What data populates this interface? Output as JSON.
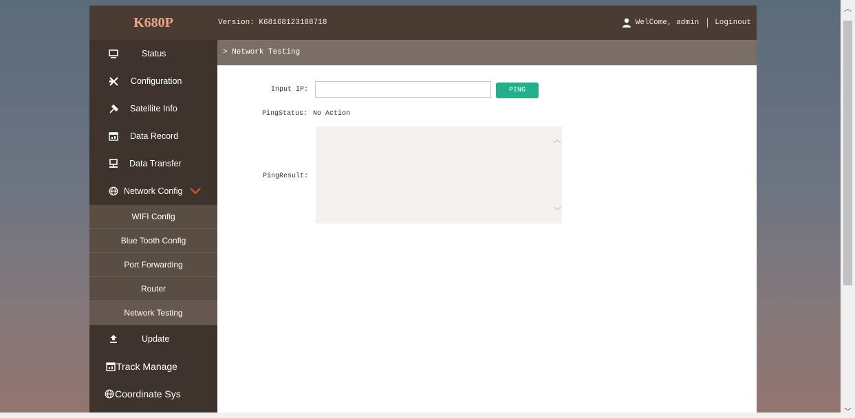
{
  "header": {
    "logo": "K680P",
    "version_label": "Version:",
    "version": "K68168123188718",
    "welcome": "WelCome, admin",
    "logout": "Loginout"
  },
  "sidebar": {
    "items": [
      {
        "label": "Status",
        "icon": "monitor-icon"
      },
      {
        "label": "Configuration",
        "icon": "tools-icon"
      },
      {
        "label": "Satellite Info",
        "icon": "satellite-icon"
      },
      {
        "label": "Data Record",
        "icon": "calendar-icon"
      },
      {
        "label": "Data Transfer",
        "icon": "network-icon"
      },
      {
        "label": "Network Config",
        "icon": "globe-icon",
        "expanded": true
      }
    ],
    "subitems": [
      "WIFI Config",
      "Blue Tooth Config",
      "Port Forwarding",
      "Router",
      "Network Testing"
    ],
    "more_items": [
      {
        "label": "Update",
        "icon": "upload-icon"
      },
      {
        "label": "Track Manage",
        "icon": "calendar-icon"
      },
      {
        "label": "Coordinate Sys",
        "icon": "globe-icon"
      }
    ]
  },
  "breadcrumb": "> Network Testing",
  "form": {
    "input_ip_label": "Input IP:",
    "input_ip_value": "",
    "ping_button": "PING",
    "ping_status_label": "PingStatus:",
    "ping_status_value": "No Action",
    "ping_result_label": "PingResult:",
    "ping_result_value": ""
  },
  "colors": {
    "header": "#4a3b33",
    "sidebar": "#3f342d",
    "submenu": "#5a4d44",
    "breadcrumb": "#7b6e67",
    "logo": "#f0a48a",
    "accent": "#21b08a",
    "chevron": "#e4572e"
  }
}
